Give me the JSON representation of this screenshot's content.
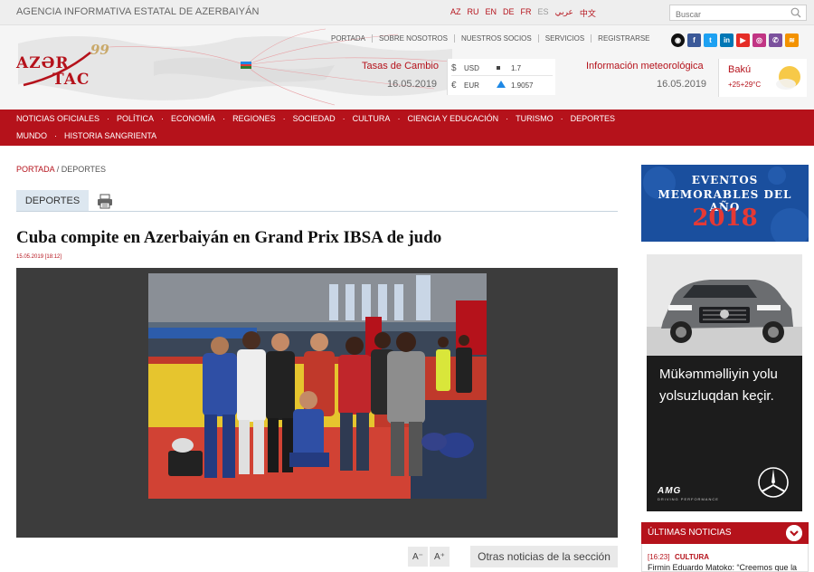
{
  "topbar": {
    "agency": "Agencia Informativa Estatal de Azerbaiyán",
    "languages": [
      "AZ",
      "RU",
      "EN",
      "DE",
      "FR",
      "ES",
      "عربي",
      "中文"
    ],
    "search_placeholder": "Buscar"
  },
  "header": {
    "logo_line1": "AZƏR",
    "logo_line2": "TAC",
    "logo_years": "99",
    "nav": [
      "PORTADA",
      "SOBRE NOSOTROS",
      "NUESTROS SOCIOS",
      "SERVICIOS",
      "REGISTRARSE"
    ],
    "socials": [
      {
        "name": "eye-icon",
        "label": "◉",
        "color": "#111111"
      },
      {
        "name": "facebook-icon",
        "label": "f",
        "color": "#3b5998"
      },
      {
        "name": "twitter-icon",
        "label": "t",
        "color": "#1da1f2"
      },
      {
        "name": "linkedin-icon",
        "label": "in",
        "color": "#0077b5"
      },
      {
        "name": "youtube-icon",
        "label": "▶",
        "color": "#e52d27"
      },
      {
        "name": "instagram-icon",
        "label": "◎",
        "color": "#c13584"
      },
      {
        "name": "viber-icon",
        "label": "✆",
        "color": "#7b519d"
      },
      {
        "name": "rss-icon",
        "label": "≋",
        "color": "#f39200"
      }
    ],
    "rates": {
      "title": "Tasas de Cambio",
      "date": "16.05.2019",
      "rows": [
        {
          "symbol": "$",
          "code": "USD",
          "value": "1.7"
        },
        {
          "symbol": "€",
          "code": "EUR",
          "value": "1.9057"
        }
      ]
    },
    "weather": {
      "title": "Información meteorológica",
      "date": "16.05.2019",
      "city": "Bakú",
      "temp": "+25+29°C"
    }
  },
  "mainnav": {
    "row1": [
      "NOTICIAS OFICIALES",
      "POLÍTICA",
      "ECONOMÍA",
      "REGIONES",
      "SOCIEDAD",
      "CULTURA",
      "CIENCIA Y EDUCACIÓN",
      "TURISMO",
      "DEPORTES"
    ],
    "row2": [
      "MUNDO",
      "HISTORIA SANGRIENTA"
    ]
  },
  "article": {
    "breadcrumb_home": "PORTADA",
    "breadcrumb_sep": " / ",
    "breadcrumb_current": "DEPORTES",
    "section_tab": "DEPORTES",
    "title": "Cuba compite en Azerbaiyán en Grand Prix IBSA de judo",
    "timestamp": "15.05.2019 [18:12]",
    "font_smaller": "A⁻",
    "font_larger": "A⁺",
    "more_button": "Otras noticias de la sección"
  },
  "sidebar": {
    "banner1_line1": "EVENTOS",
    "banner1_line2": "MEMORABLES DEL AÑO",
    "banner1_year": "2018",
    "banner2_line1": "Mükəmməlliyin yolu",
    "banner2_line2": "yolsuzluqdan keçir.",
    "banner2_brand": "AMG",
    "banner2_brand_sub": "DRIVING PERFORMANCE",
    "news_title": "ÚLTIMAS NOTICIAS",
    "news_item": {
      "time": "[16:23]",
      "category": "CULTURA",
      "title": "Firmin Eduardo Matoko: “Creemos que la"
    }
  }
}
